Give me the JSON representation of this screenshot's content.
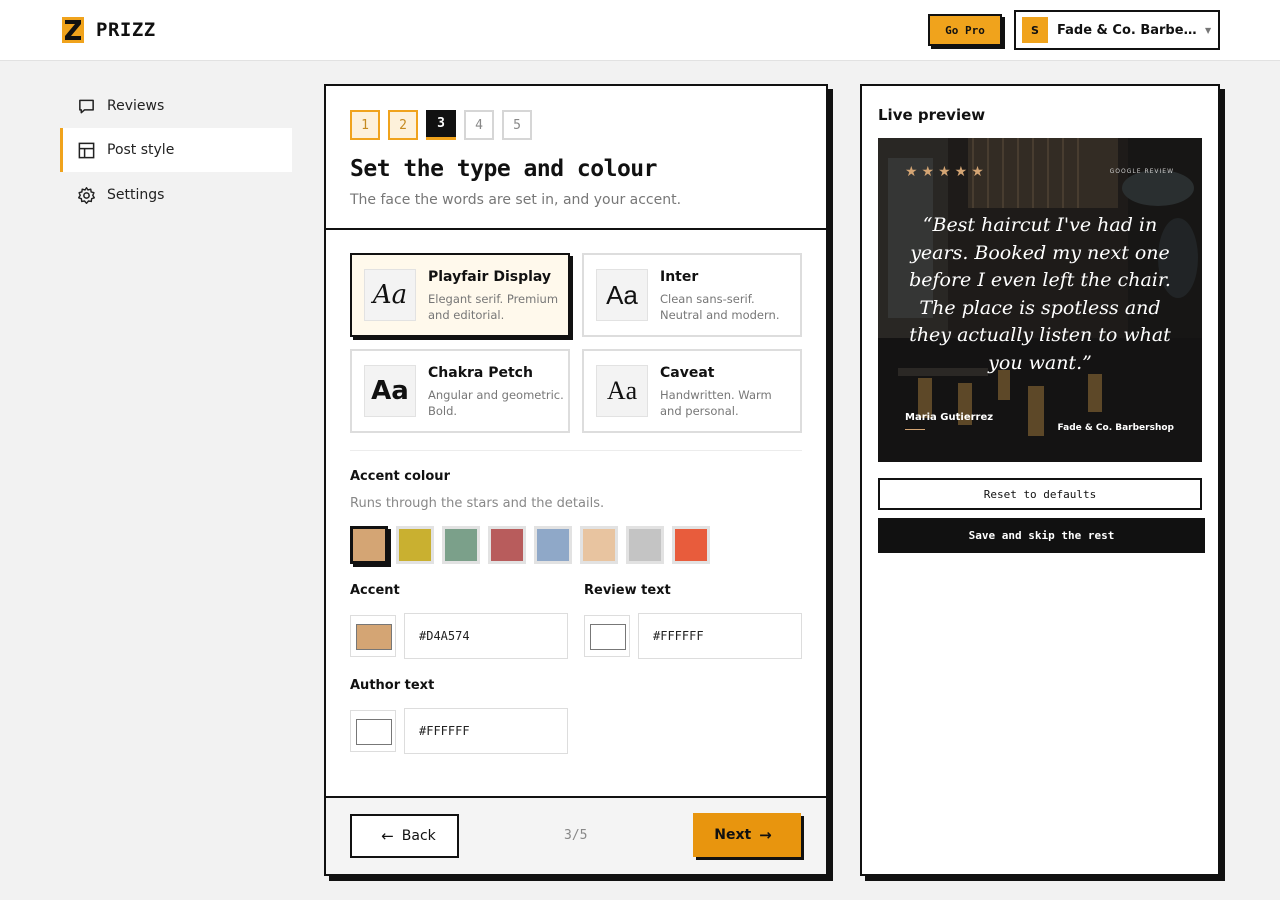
{
  "brand": {
    "name": "PRIZZ",
    "accent": "#f0a31c"
  },
  "header": {
    "go_pro_label": "Go Pro",
    "business": {
      "initial": "S",
      "name": "Fade & Co. Barbershop"
    }
  },
  "sidebar": {
    "items": [
      {
        "label": "Reviews",
        "icon": "chat-bubble-icon",
        "active": false
      },
      {
        "label": "Post style",
        "icon": "layout-icon",
        "active": true
      },
      {
        "label": "Settings",
        "icon": "gear-icon",
        "active": false
      }
    ]
  },
  "wizard": {
    "steps": [
      "1",
      "2",
      "3",
      "4",
      "5"
    ],
    "current_step": 3,
    "title": "Set the type and colour",
    "subtitle": "The face the words are set in, and your accent.",
    "fonts": [
      {
        "sample": "Aa",
        "name": "Playfair Display",
        "desc": "Elegant serif. Premium and editorial.",
        "selected": true
      },
      {
        "sample": "Aa",
        "name": "Inter",
        "desc": "Clean sans-serif. Neutral and modern.",
        "selected": false
      },
      {
        "sample": "Aa",
        "name": "Chakra Petch",
        "desc": "Angular and geometric. Bold.",
        "selected": false
      },
      {
        "sample": "Aa",
        "name": "Caveat",
        "desc": "Handwritten. Warm and personal.",
        "selected": false
      }
    ],
    "accent_section": {
      "label": "Accent colour",
      "hint": "Runs through the stars and the details.",
      "swatches": [
        "#D4A574",
        "#C9B030",
        "#7BA08A",
        "#B85C5C",
        "#8FA8C8",
        "#E8C4A0",
        "#C4C4C4",
        "#E85C3C"
      ],
      "selected_index": 0
    },
    "color_fields": {
      "accent": {
        "label": "Accent",
        "value": "#D4A574"
      },
      "review_text": {
        "label": "Review text",
        "value": "#FFFFFF"
      },
      "author_text": {
        "label": "Author text",
        "value": "#FFFFFF"
      }
    },
    "footer": {
      "back_label": "Back",
      "step_count": "3/5",
      "next_label": "Next"
    }
  },
  "preview": {
    "title": "Live preview",
    "card": {
      "stars": "★★★★★",
      "source": "GOOGLE REVIEW",
      "quote": "“Best haircut I've had in years. Booked my next one before I even left the chair. The place is spotless and they actually listen to what you want.”",
      "author": "Maria Gutierrez",
      "business": "Fade & Co. Barbershop"
    },
    "reset_label": "Reset to defaults",
    "save_label": "Save and skip the rest"
  }
}
